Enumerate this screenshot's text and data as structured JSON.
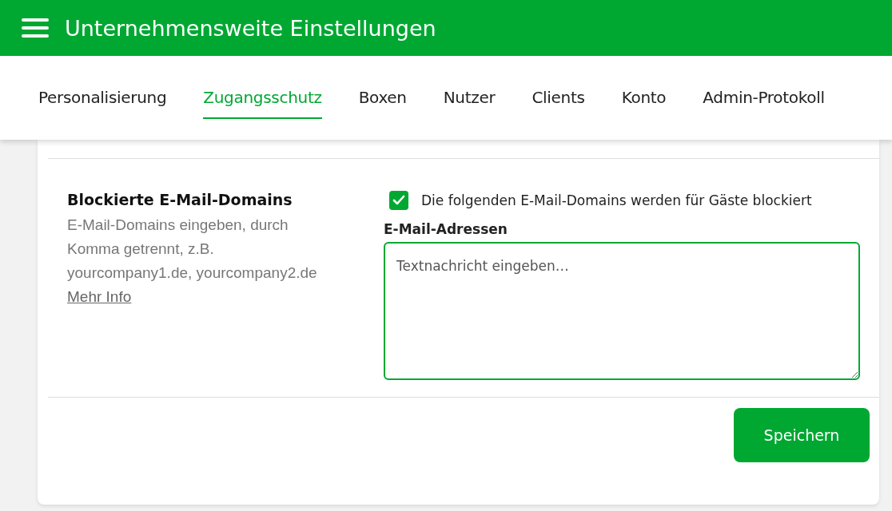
{
  "header": {
    "title": "Unternehmensweite Einstellungen"
  },
  "tabs": [
    {
      "label": "Personalisierung",
      "selected": false
    },
    {
      "label": "Zugangsschutz",
      "selected": true
    },
    {
      "label": "Boxen",
      "selected": false
    },
    {
      "label": "Nutzer",
      "selected": false
    },
    {
      "label": "Clients",
      "selected": false
    },
    {
      "label": "Konto",
      "selected": false
    },
    {
      "label": "Admin-Protokoll",
      "selected": false
    }
  ],
  "section": {
    "title": "Blockierte E-Mail-Domains",
    "description": "E-Mail-Domains eingeben, durch Komma getrennt, z.B. yourcompany1.de, yourcompany2.de",
    "link": "Mehr Info",
    "checkbox": {
      "label": "Die folgenden E-Mail-Domains werden für Gäste blockiert",
      "checked": true
    },
    "field": {
      "label": "E-Mail-Adressen",
      "placeholder": "Textnachricht eingeben…"
    }
  },
  "save_button": "Speichern"
}
